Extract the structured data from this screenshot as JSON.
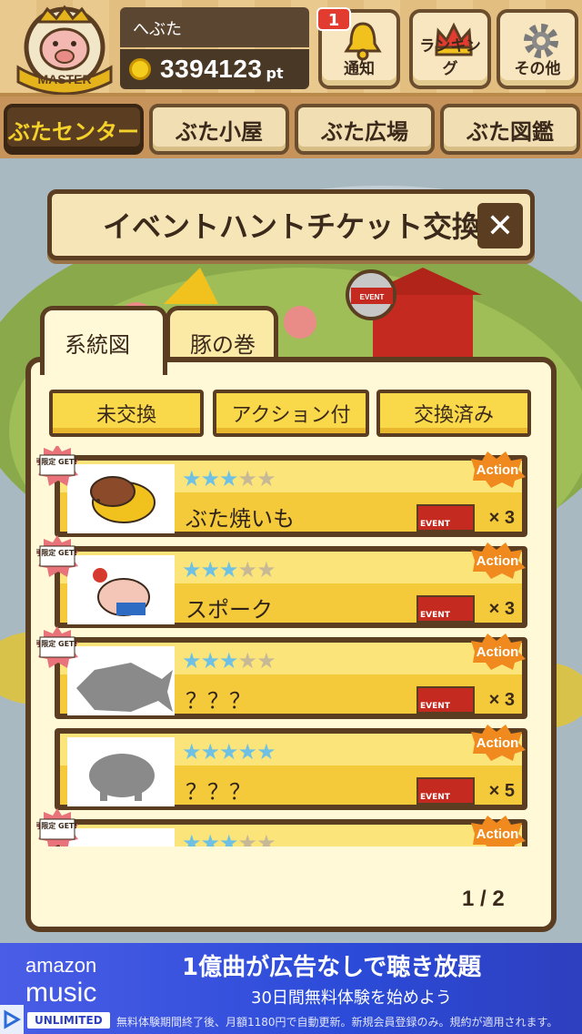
{
  "header": {
    "avatar_label": "MASTER",
    "username": "へぶた",
    "points": "3394123",
    "points_unit": "pt",
    "buttons": [
      {
        "label": "通知",
        "badge": "1"
      },
      {
        "label": "ランキング"
      },
      {
        "label": "その他"
      }
    ]
  },
  "nav": {
    "tabs": [
      "ぶたセンター",
      "ぶた小屋",
      "ぶた広場",
      "ぶた図鑑"
    ],
    "active": 0
  },
  "scene": {
    "shop_sign": "EVENT"
  },
  "dialog": {
    "title": "イベントハントチケット交換所",
    "close_symbol": "✕",
    "tabs": [
      "系統図",
      "豚の巻"
    ],
    "filters": [
      "未交換",
      "アクション付",
      "交換済み"
    ],
    "items": [
      {
        "name": "ぶた焼いも",
        "stars": 3,
        "count": "× 3",
        "limited": true
      },
      {
        "name": "スポーク",
        "stars": 3,
        "count": "× 3",
        "limited": true
      },
      {
        "name": "？？？",
        "stars": 3,
        "count": "× 3",
        "limited": true
      },
      {
        "name": "？？？",
        "stars": 5,
        "count": "× 5",
        "limited": false
      },
      {
        "name": "",
        "stars": 3,
        "count": "",
        "limited": true
      }
    ],
    "action_label": "Action",
    "event_tag": "EVENT",
    "limited_badge": "月限定 GET!!",
    "pager": "1 / 2"
  },
  "ad": {
    "brand_top": "amazon",
    "brand_main": "music",
    "brand_tag": "UNLIMITED",
    "headline": "1億曲が広告なしで聴き放題",
    "subline": "30日間無料体験を始めよう",
    "footnote": "無料体験期間終了後、月額1180円で自動更新。新規会員登録のみ。規約が適用されます。"
  },
  "colors": {
    "wood": "#5b3d22",
    "panel": "#fff9d7",
    "yellow": "#f9d94a",
    "star": "#6fc1e4"
  }
}
